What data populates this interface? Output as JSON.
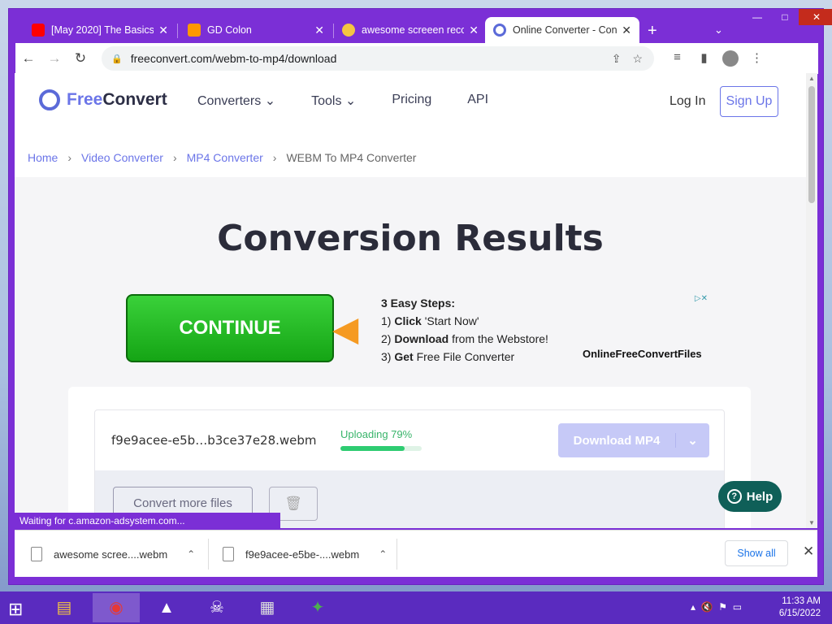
{
  "browser": {
    "tabs": [
      {
        "title": "[May 2020] The Basics",
        "favicon": "youtube-icon",
        "color": "#ff0000"
      },
      {
        "title": "GD Colon",
        "favicon": "gd-icon",
        "color": "#ff9800"
      },
      {
        "title": "awesome screeen recor",
        "favicon": "face-icon",
        "color": "#f4c542"
      },
      {
        "title": "Online Converter - Con",
        "favicon": "freeconvert-icon",
        "color": "#5b6ad8",
        "active": true
      }
    ],
    "url": "freeconvert.com/webm-to-mp4/download"
  },
  "site": {
    "logo_free": "Free",
    "logo_convert": "Convert",
    "nav": [
      "Converters",
      "Tools",
      "Pricing",
      "API"
    ],
    "login": "Log In",
    "signup": "Sign Up",
    "breadcrumbs": [
      "Home",
      "Video Converter",
      "MP4 Converter",
      "WEBM To MP4 Converter"
    ],
    "title": "Conversion Results"
  },
  "ad": {
    "button": "CONTINUE",
    "heading": "3 Easy Steps:",
    "step1_bold": "Click",
    "step1_rest": " 'Start Now'",
    "step2_bold": "Download",
    "step2_rest": " from the Webstore!",
    "step3_bold": "Get",
    "step3_rest": " Free File Converter",
    "brand": "OnlineFreeConvertFiles"
  },
  "file": {
    "name": "f9e9acee-e5b…b3ce37e28.webm",
    "status": "Uploading 79%",
    "progress": 0.79,
    "download_label": "Download MP4",
    "convert_more": "Convert more files"
  },
  "help": "Help",
  "status_text": "Waiting for c.amazon-adsystem.com...",
  "downloads": {
    "items": [
      "awesome scree....webm",
      "f9e9acee-e5be-....webm"
    ],
    "show_all": "Show all"
  },
  "clock": {
    "time": "11:33 AM",
    "date": "6/15/2022"
  }
}
